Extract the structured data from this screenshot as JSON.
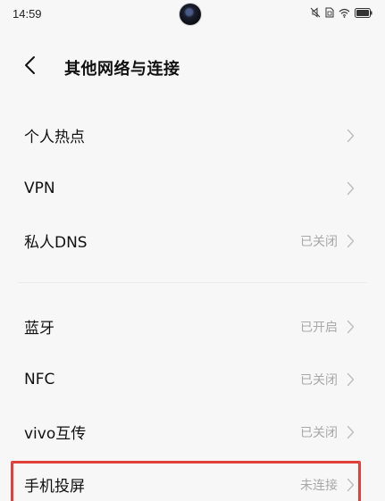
{
  "status_bar": {
    "time": "14:59",
    "icons": [
      "mute-icon",
      "sim-icon",
      "wifi-icon",
      "battery-icon"
    ]
  },
  "header": {
    "title": "其他网络与连接",
    "back_icon": "chevron-left-icon"
  },
  "groups": [
    {
      "items": [
        {
          "label": "个人热点",
          "value": ""
        },
        {
          "label": "VPN",
          "value": ""
        },
        {
          "label": "私人DNS",
          "value": "已关闭"
        }
      ]
    },
    {
      "items": [
        {
          "label": "蓝牙",
          "value": "已开启"
        },
        {
          "label": "NFC",
          "value": "已关闭"
        },
        {
          "label": "vivo互传",
          "value": "已关闭"
        },
        {
          "label": "手机投屏",
          "value": "未连接"
        }
      ]
    }
  ],
  "highlight_color": "#e2403a"
}
